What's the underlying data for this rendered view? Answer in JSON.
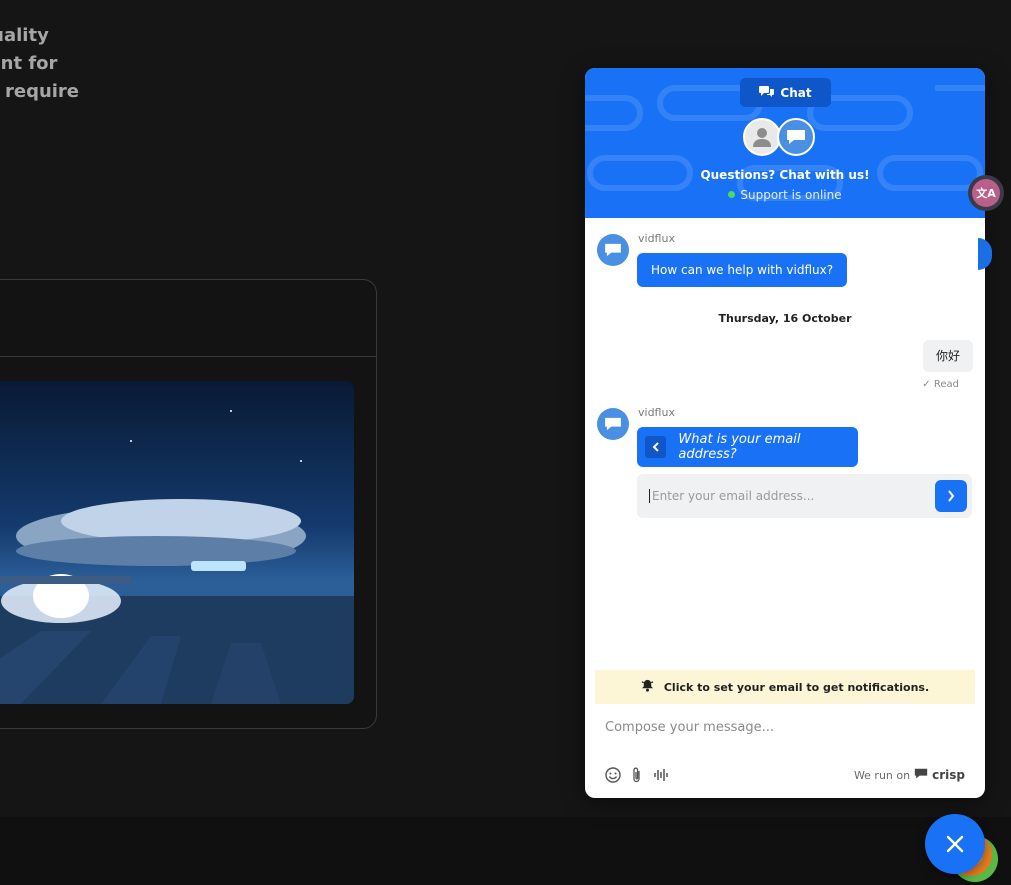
{
  "background": {
    "intro_lines": [
      "h-quality",
      "ntent for",
      "s required."
    ]
  },
  "chat": {
    "tab_label": "Chat",
    "header_title": "Questions? Chat with us!",
    "status_text": "Support is online",
    "operator_name": "vidflux",
    "messages": {
      "greeting": "How can we help with vidflux?",
      "date_separator": "Thursday, 16 October",
      "user_message": "你好",
      "read_receipt": "Read",
      "email_question": "What is your email address?"
    },
    "email_input": {
      "value": "",
      "placeholder": "Enter your email address..."
    },
    "notification_text": "Click to set your email to get notifications.",
    "compose": {
      "value": "",
      "placeholder": "Compose your message..."
    },
    "powered_by_prefix": "We run on",
    "powered_by_brand": "crisp"
  },
  "translate_button_label": "文A",
  "colors": {
    "accent": "#1972f5",
    "accent_dark": "#0f57c9",
    "online": "#4cd964",
    "notify_bg": "#fdf6d6"
  },
  "icons": {
    "tab": "chat-bubbles-icon",
    "notify": "bell-icon",
    "emoji": "smiley-icon",
    "attach": "paperclip-icon",
    "audio": "waveform-icon",
    "close": "close-icon"
  }
}
